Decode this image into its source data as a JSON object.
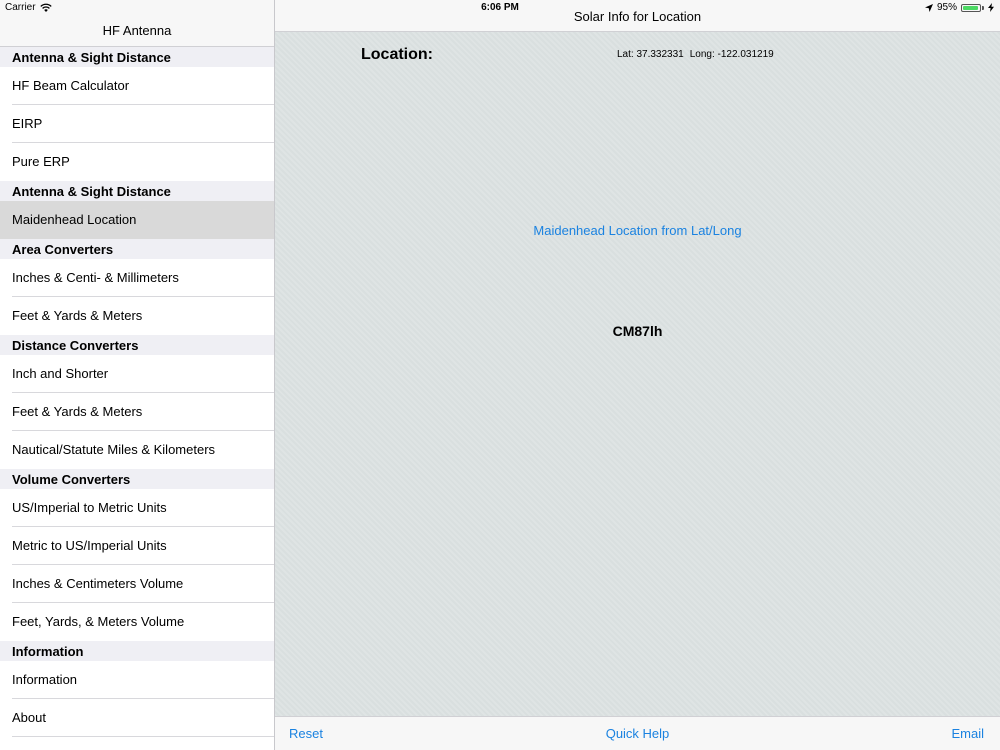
{
  "status_bar": {
    "carrier": "Carrier",
    "time": "6:06 PM",
    "battery": "95%",
    "battery_level": 0.95,
    "icons": [
      "wifi-icon",
      "location-arrow-icon",
      "battery-icon",
      "charging-bolt-icon"
    ]
  },
  "sidebar": {
    "title": "HF Antenna",
    "sections": [
      {
        "header": "Antenna & Sight Distance",
        "items": [
          "HF Beam Calculator",
          "EIRP",
          "Pure ERP"
        ]
      },
      {
        "header": "Antenna & Sight Distance",
        "items": [
          "Maidenhead Location"
        ]
      },
      {
        "header": "Area Converters",
        "items": [
          "Inches & Centi- & Millimeters",
          "Feet & Yards & Meters"
        ]
      },
      {
        "header": "Distance Converters",
        "items": [
          "Inch and Shorter",
          "Feet & Yards & Meters",
          "Nautical/Statute Miles & Kilometers"
        ]
      },
      {
        "header": "Volume Converters",
        "items": [
          "US/Imperial to Metric Units",
          "Metric to US/Imperial Units",
          "Inches & Centimeters Volume",
          "Feet, Yards, & Meters Volume"
        ]
      },
      {
        "header": "Information",
        "items": [
          "Information",
          "About"
        ]
      }
    ],
    "selected_item": "Maidenhead Location"
  },
  "main": {
    "title": "Solar Info for Location",
    "location_label": "Location:",
    "lat": "Lat: 37.332331",
    "long": "Long: -122.031219",
    "maidenhead_button": "Maidenhead Location from Lat/Long",
    "grid_square": "CM87lh"
  },
  "toolbar": {
    "reset_label": "Reset",
    "help_label": "Quick Help",
    "email_label": "Email"
  },
  "colors": {
    "accent": "#1a82e0",
    "main_background": "#dde3e3",
    "selected_row": "#d9d9d9",
    "section_header": "#efeff4",
    "battery": "#4cd964"
  }
}
